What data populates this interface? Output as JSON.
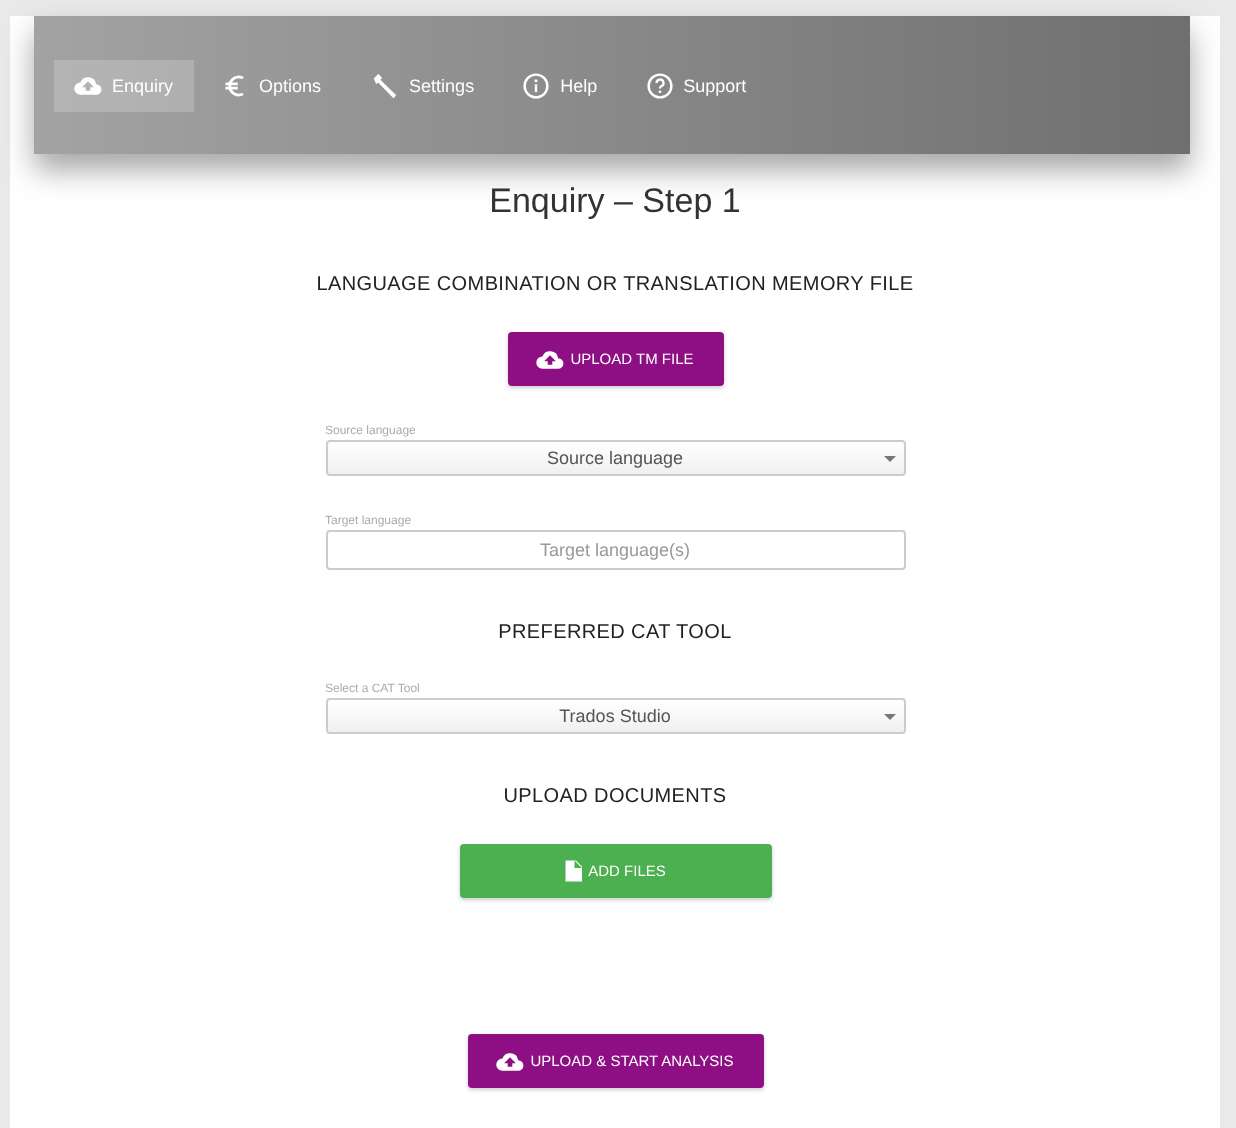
{
  "nav": [
    {
      "label": "Enquiry",
      "selected": true
    },
    {
      "label": "Options",
      "selected": false
    },
    {
      "label": "Settings",
      "selected": false
    },
    {
      "label": "Help",
      "selected": false
    },
    {
      "label": "Support",
      "selected": false
    }
  ],
  "title": "Enquiry – Step 1",
  "blocks": [
    {
      "kind": "heading",
      "text": "LANGUAGE COMBINATION OR TRANSLATION MEMORY FILE"
    },
    {
      "kind": "button",
      "label": "UPLOAD TM FILE",
      "color": "#8e0f83"
    },
    {
      "kind": "select",
      "label": "Source language",
      "value": "Source language"
    },
    {
      "kind": "input",
      "label": "Target language",
      "placeholder": "Target language(s)"
    },
    {
      "kind": "heading",
      "text": "PREFERRED CAT TOOL"
    },
    {
      "kind": "select",
      "label": "Select a CAT Tool",
      "value": "Trados Studio"
    },
    {
      "kind": "heading",
      "text": "UPLOAD DOCUMENTS"
    },
    {
      "kind": "button",
      "label": "ADD FILES",
      "color": "#4caf50"
    },
    {
      "kind": "spacer"
    },
    {
      "kind": "button",
      "label": "UPLOAD & START ANALYSIS",
      "color": "#8e0f83"
    }
  ]
}
